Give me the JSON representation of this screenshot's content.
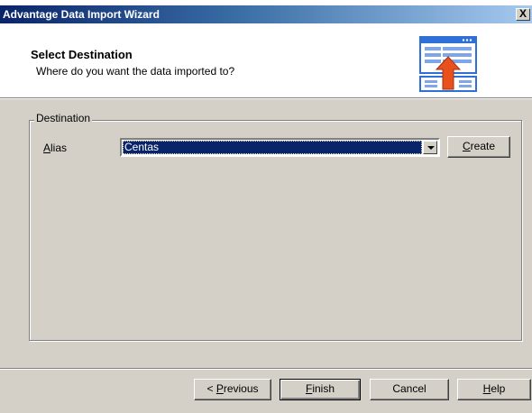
{
  "window": {
    "title": "Advantage Data Import Wizard",
    "close_glyph": "X"
  },
  "header": {
    "title": "Select Destination",
    "subtitle": "Where do you want the data imported to?",
    "icon": "import-table-icon"
  },
  "destination": {
    "group_label": "Destination",
    "alias_label_accel": "A",
    "alias_label_rest": "lias",
    "alias_value": "Centas",
    "create_accel": "C",
    "create_rest": "reate"
  },
  "footer": {
    "previous_prefix": "< ",
    "previous_accel": "P",
    "previous_rest": "revious",
    "finish_accel": "F",
    "finish_rest": "inish",
    "cancel_label": "Cancel",
    "help_accel": "H",
    "help_rest": "elp"
  },
  "colors": {
    "title_bar": "#0a246a",
    "dialog_face": "#d4d0c8",
    "selection": "#0a246a",
    "icon_arrow": "#e8501c",
    "icon_blue": "#2f6fd8"
  }
}
